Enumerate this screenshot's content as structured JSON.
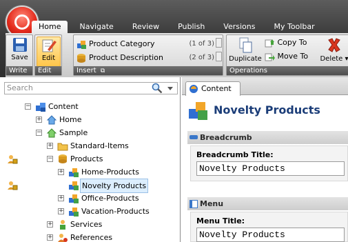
{
  "ribbon_tabs": [
    "Home",
    "Navigate",
    "Review",
    "Publish",
    "Versions",
    "My Toolbar"
  ],
  "groups": {
    "write": {
      "label": "Write",
      "save_label": "Save"
    },
    "edit": {
      "label": "Edit",
      "edit_label": "Edit"
    },
    "insert": {
      "label": "Insert",
      "items": [
        {
          "label": "Product Category",
          "count": "(1 of 3)"
        },
        {
          "label": "Product Description",
          "count": "(2 of 3)"
        }
      ]
    },
    "operations": {
      "label": "Operations",
      "duplicate": "Duplicate",
      "copy_to": "Copy To",
      "move_to": "Move To",
      "delete": "Delete"
    }
  },
  "search": {
    "placeholder": "Search"
  },
  "tree": {
    "content": "Content",
    "home": "Home",
    "sample": "Sample",
    "standard_items": "Standard-Items",
    "products": "Products",
    "home_products": "Home-Products",
    "novelty_products": "Novelty Products",
    "office_products": "Office-Products",
    "vacation_products": "Vacation-Products",
    "services": "Services",
    "references": "References"
  },
  "editor": {
    "tab_label": "Content",
    "item_title": "Novelty Products",
    "sections": [
      {
        "header": "Breadcrumb",
        "field_label": "Breadcrumb Title:",
        "field_value": "Novelty Products"
      },
      {
        "header": "Menu",
        "field_label": "Menu Title:",
        "field_value": "Novelty Products"
      }
    ]
  },
  "colors": {
    "accent": "#1b3d78",
    "selection": "#dceefd",
    "orb": "#e52b1c"
  }
}
